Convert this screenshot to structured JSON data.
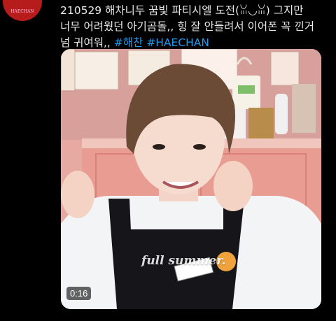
{
  "tweet": {
    "line1": "210529 해차니두 꿈빛 파티시엘 도전(ꈍ◡ꈍ) 그지만",
    "line2": "너무 어려웠던 아기곰돌,, 힝 잘 안들려서 이어폰 꼭 낀거",
    "line3_text": "넘 귀여워,, ",
    "hashtag1": "#해찬",
    "hashtag2": "#HAECHAN"
  },
  "media": {
    "caption": "full summer.",
    "duration": "0:16",
    "name_tag": "HAECHAN"
  },
  "colors": {
    "background": "#000000",
    "text": "#e7e9ea",
    "link": "#1d9bf0"
  },
  "icons": [
    "avatar"
  ]
}
